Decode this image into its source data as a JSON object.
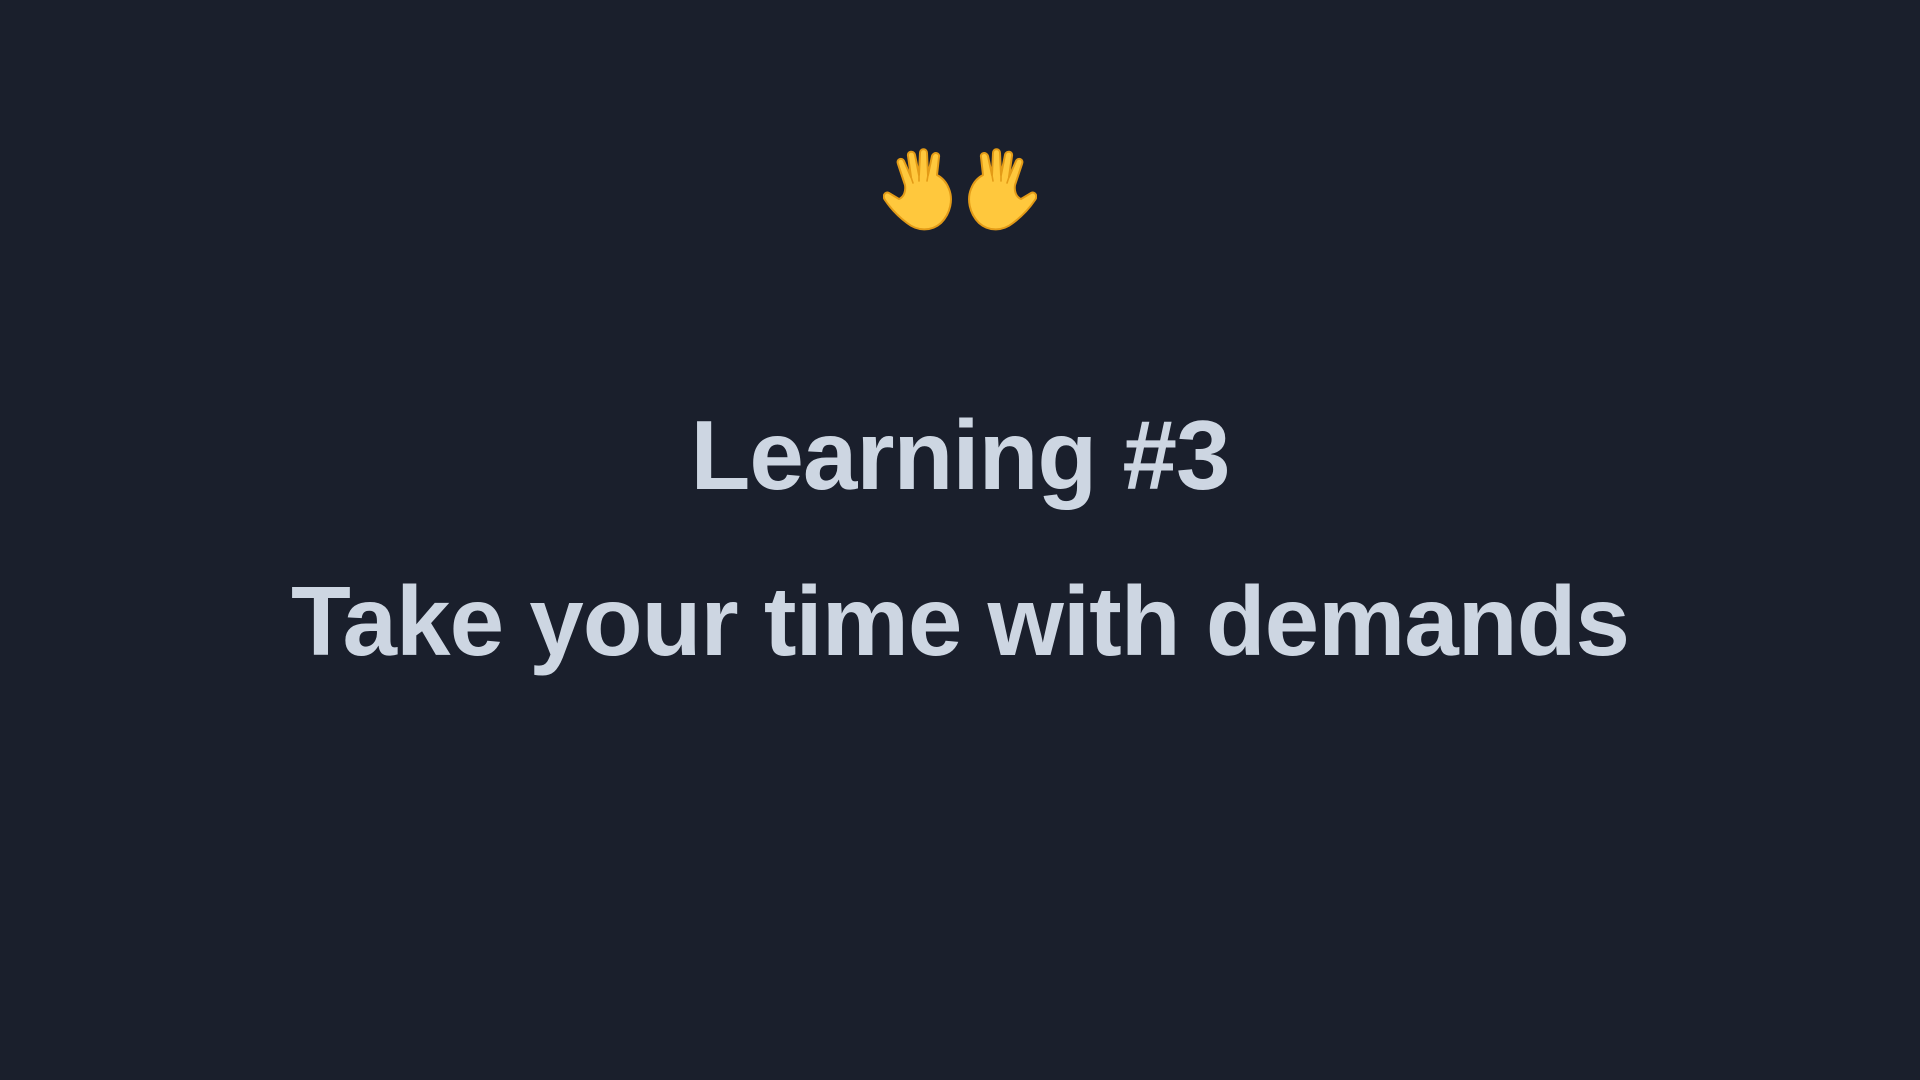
{
  "slide": {
    "icon": "raised-hands-icon",
    "title": "Learning #3",
    "subtitle": "Take your time with demands",
    "colors": {
      "background": "#1a1f2c",
      "text": "#cdd6e2",
      "hand_fill": "#ffc83d",
      "hand_shade": "#e8a51f"
    }
  }
}
